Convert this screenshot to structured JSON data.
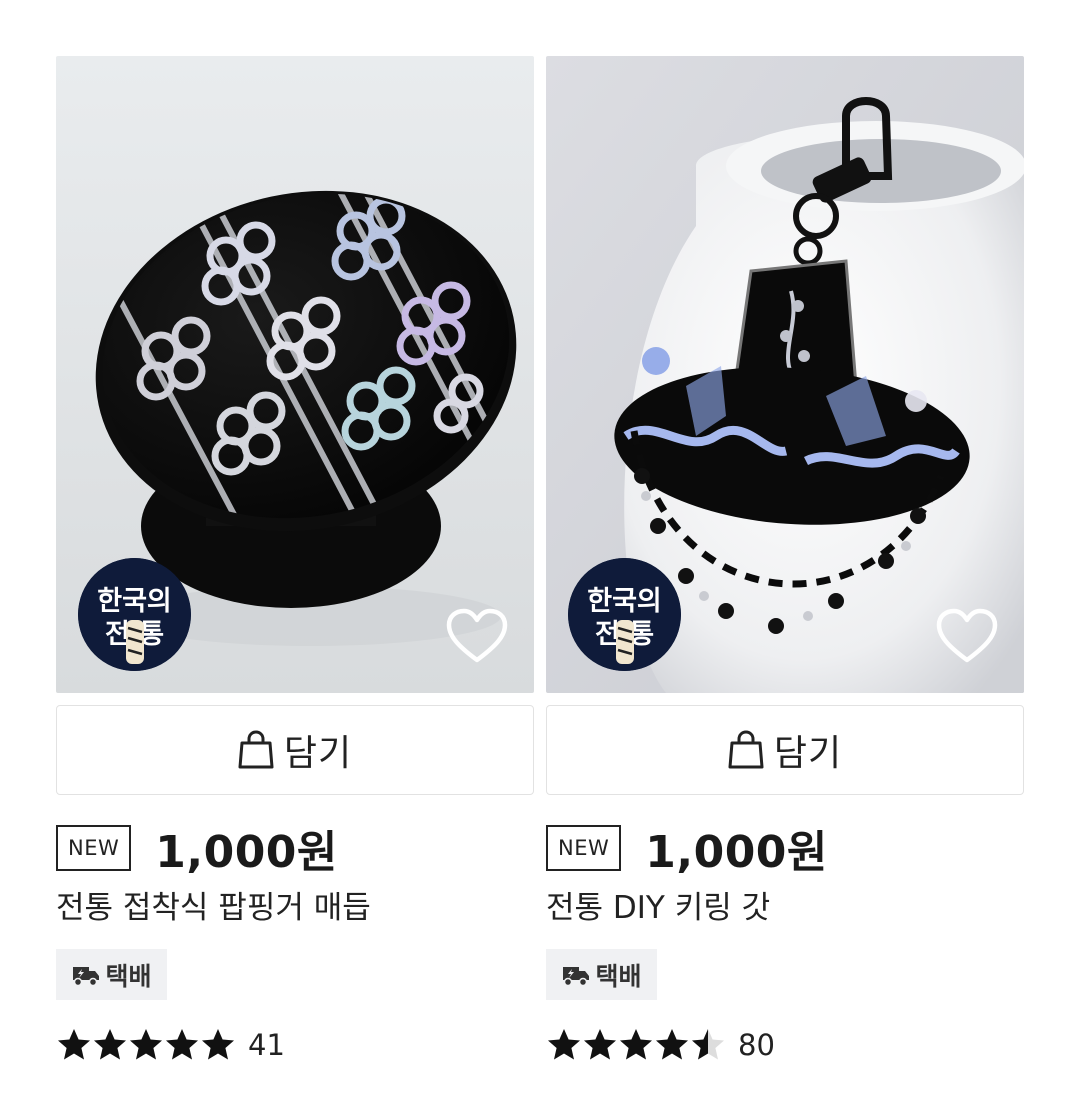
{
  "products": [
    {
      "brand_badge_text": [
        "한국의",
        "전 통"
      ],
      "cart_label": "담기",
      "new_label": "NEW",
      "price": "1,000원",
      "title": "전통 접착식 팝핑거 매듭",
      "shipping_label": "택배",
      "rating": 5.0,
      "review_count": "41"
    },
    {
      "brand_badge_text": [
        "한국의",
        "전 통"
      ],
      "cart_label": "담기",
      "new_label": "NEW",
      "price": "1,000원",
      "title": "전통 DIY 키링 갓",
      "shipping_label": "택배",
      "rating": 4.5,
      "review_count": "80"
    }
  ],
  "colors": {
    "star": "#111111",
    "star_empty": "#dddddd",
    "badge_bg": "#0f1b3a",
    "shipping_bg": "#f0f1f3"
  },
  "icons": [
    "shopping-bag-icon",
    "heart-icon",
    "delivery-truck-icon",
    "star-icon"
  ]
}
